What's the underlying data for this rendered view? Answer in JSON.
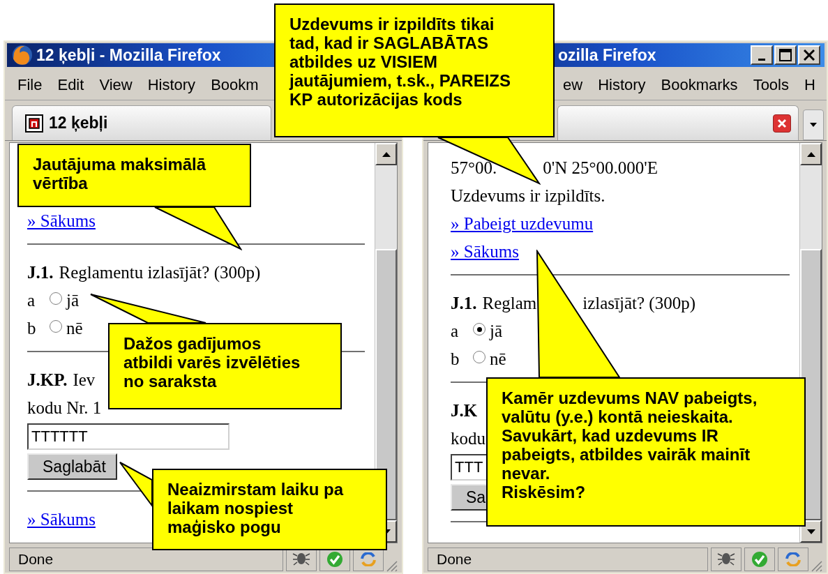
{
  "windows": [
    {
      "title": "12 ķebļi - Mozilla Firefox",
      "menu": [
        "File",
        "Edit",
        "View",
        "History",
        "Bookm"
      ],
      "tab_title": "12 ķebļi",
      "status": "Done",
      "content": [
        {
          "kind": "link",
          "text": "» Sākums"
        },
        {
          "kind": "rule"
        },
        {
          "kind": "question",
          "label": "J.1.",
          "parts": [
            "Reglamentu izlasījāt? (300p)"
          ]
        },
        {
          "kind": "option",
          "letter": "a",
          "label": "jā",
          "selected": false
        },
        {
          "kind": "option",
          "letter": "b",
          "label": "nē",
          "selected": false
        },
        {
          "kind": "rule"
        },
        {
          "kind": "question",
          "label": "J.KP.",
          "parts": [
            "Iev"
          ]
        },
        {
          "kind": "text",
          "parts": [
            "kodu Nr. 1"
          ]
        },
        {
          "kind": "input",
          "value": "TTTTTT"
        },
        {
          "kind": "button",
          "text": "Saglabāt"
        },
        {
          "kind": "rule"
        },
        {
          "kind": "link",
          "text": "» Sākums"
        }
      ]
    },
    {
      "title": "ozilla Firefox",
      "menu": [
        "ew",
        "History",
        "Bookmarks",
        "Tools",
        "H"
      ],
      "status": "Done",
      "content": [
        {
          "kind": "text",
          "parts": [
            "57°00.",
            "0'N 25°00.000'E"
          ]
        },
        {
          "kind": "text",
          "parts": [
            "Uzdevums ir izpildīts."
          ]
        },
        {
          "kind": "link",
          "text": "» Pabeigt uzdevumu"
        },
        {
          "kind": "link",
          "text": "» Sākums"
        },
        {
          "kind": "rule"
        },
        {
          "kind": "question",
          "label": "J.1.",
          "parts": [
            "Reglam",
            "izlasījāt? (300p)"
          ]
        },
        {
          "kind": "option",
          "letter": "a",
          "label": "jā",
          "selected": true
        },
        {
          "kind": "option",
          "letter": "b",
          "label": "nē",
          "selected": false
        },
        {
          "kind": "rule"
        },
        {
          "kind": "question",
          "label": "J.K"
        },
        {
          "kind": "text",
          "parts": [
            "kodu"
          ]
        },
        {
          "kind": "input",
          "value": "TTT"
        },
        {
          "kind": "button",
          "text": "Sa"
        },
        {
          "kind": "rule"
        }
      ]
    }
  ],
  "callouts": [
    {
      "text": "Uzdevums ir izpildīts tikai\ntad, kad ir SAGLABĀTAS\natbildes uz VISIEM\njautājumiem, t.sk., PAREIZS\nKP autorizācijas kods"
    },
    {
      "text": "Jautājuma maksimālā\nvērtība"
    },
    {
      "text": "Dažos gadījumos\natbildi varēs izvēlēties\nno saraksta"
    },
    {
      "text": "Neaizmirstam laiku pa\nlaikam nospiest\nmaģisko pogu"
    },
    {
      "text": "Kamēr uzdevums NAV pabeigts,\nvalūtu (y.e.) kontā neieskaita.\nSavukārt, kad uzdevums IR\npabeigts, atbildes vairāk mainīt\nnevar.\nRiskēsim?"
    }
  ]
}
